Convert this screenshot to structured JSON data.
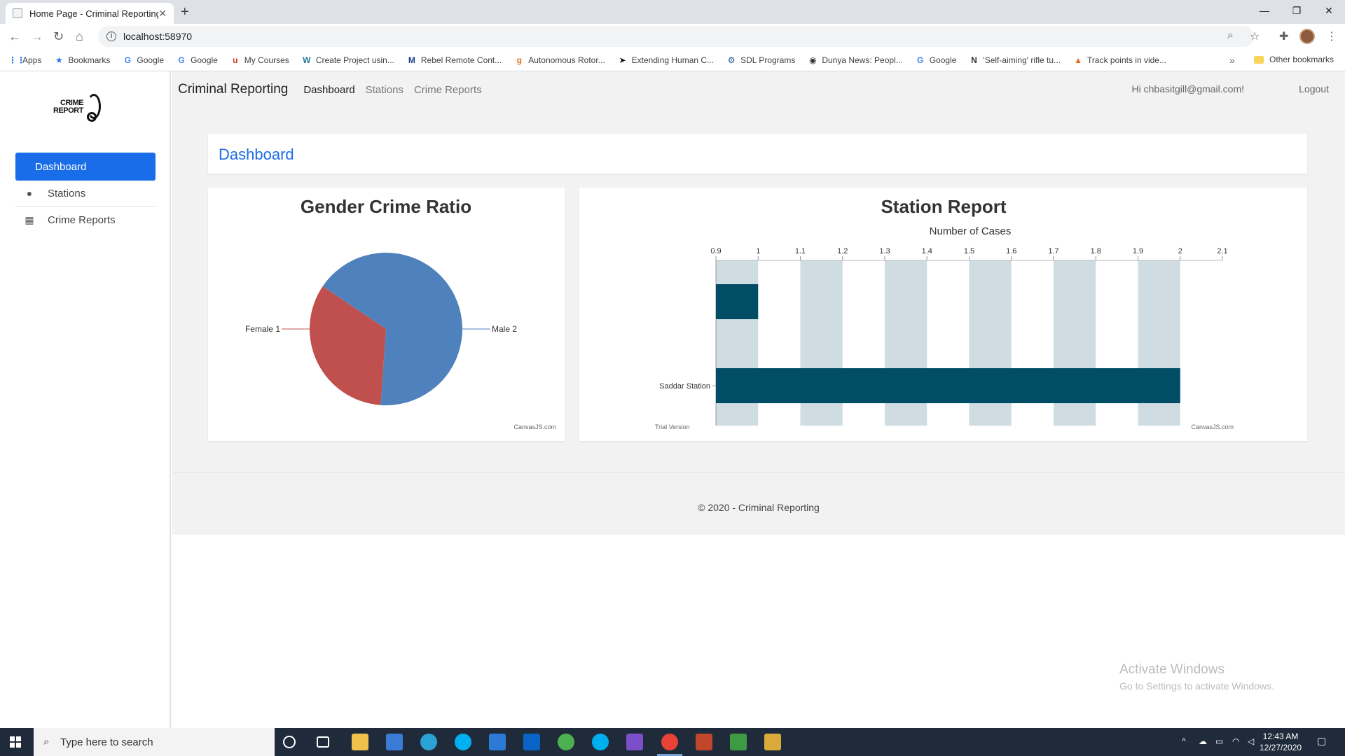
{
  "browser": {
    "tab_title": "Home Page - Criminal Reporting",
    "url": "localhost:58970",
    "bookmarks": [
      "Apps",
      "Bookmarks",
      "Google",
      "Google",
      "My Courses",
      "Create Project usin...",
      "Rebel Remote Cont...",
      "Autonomous Rotor...",
      "Extending Human C...",
      "SDL Programs",
      "Dunya News: Peopl...",
      "Google",
      "'Self-aiming' rifle tu...",
      "Track points in vide..."
    ],
    "more": "»",
    "other_bookmarks": "Other bookmarks"
  },
  "sidebar": {
    "logo_line1": "CRIME",
    "logo_line2": "REPORT",
    "items": [
      {
        "label": "Dashboard",
        "icon": "dashboard"
      },
      {
        "label": "Stations",
        "icon": "user-icon"
      },
      {
        "label": "Crime Reports",
        "icon": "table-icon"
      }
    ]
  },
  "topnav": {
    "brand": "Criminal Reporting",
    "links": [
      "Dashboard",
      "Stations",
      "Crime Reports"
    ],
    "greeting": "Hi chbasitgill@gmail.com!",
    "logout": "Logout"
  },
  "page_title": "Dashboard",
  "chart_data": [
    {
      "type": "pie",
      "title": "Gender Crime Ratio",
      "labels": [
        "Male",
        "Female"
      ],
      "values": [
        2,
        1
      ],
      "colors": [
        "#4f81bc",
        "#c0504e"
      ],
      "index_labels": [
        "Male 2",
        "Female 1"
      ],
      "credit": "CanvasJS.com"
    },
    {
      "type": "bar",
      "title": "Station Report",
      "xlabel": "Number of Cases",
      "categories": [
        "Saddar Station",
        ""
      ],
      "values": [
        2,
        1
      ],
      "xlim": [
        0.9,
        2.1
      ],
      "ticks": [
        "0.9",
        "1",
        "1.1",
        "1.2",
        "1.3",
        "1.4",
        "1.5",
        "1.6",
        "1.7",
        "1.8",
        "1.9",
        "2",
        "2.1"
      ],
      "bar_color": "#014d65",
      "stripe_color": "#cfdde3",
      "trial": "Trial Version",
      "credit": "CanvasJS.com"
    }
  ],
  "footer": "© 2020 - Criminal Reporting",
  "watermark": {
    "line1": "Activate Windows",
    "line2": "Go to Settings to activate Windows."
  },
  "taskbar": {
    "search_placeholder": "Type here to search",
    "time": "12:43 AM",
    "date": "12/27/2020"
  }
}
